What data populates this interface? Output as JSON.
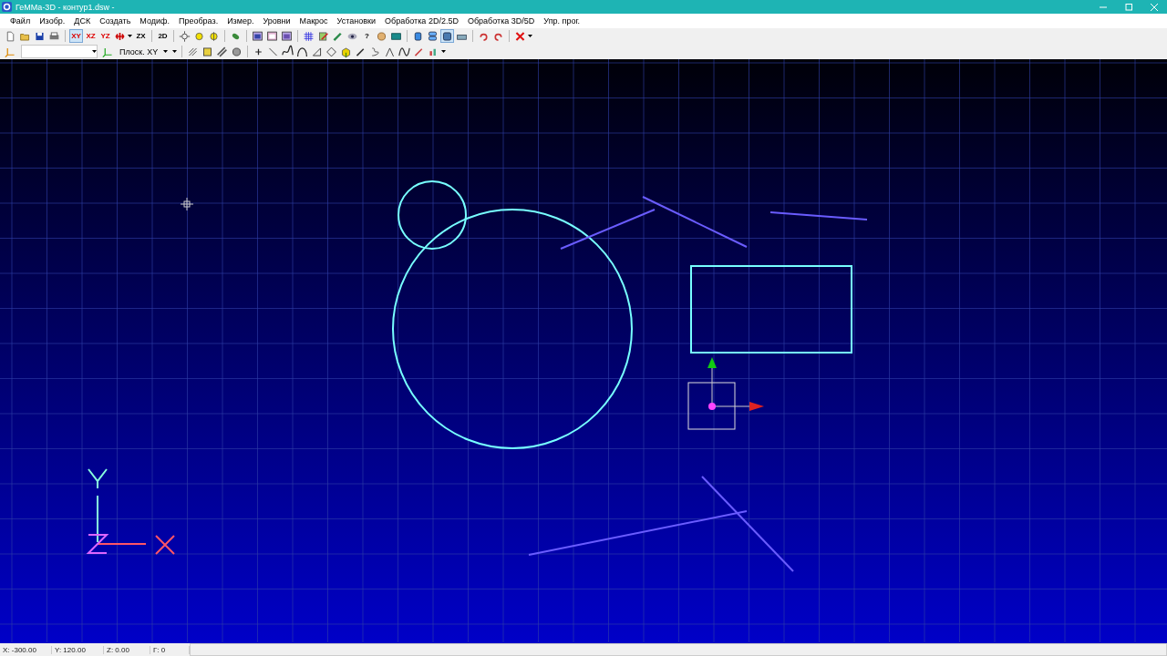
{
  "window": {
    "title": "ГеММа-3D - контур1.dsw -"
  },
  "menu": [
    {
      "label": "Файл"
    },
    {
      "label": "Изобр."
    },
    {
      "label": "ДСК"
    },
    {
      "label": "Создать"
    },
    {
      "label": "Модиф."
    },
    {
      "label": "Преобраз."
    },
    {
      "label": "Измер."
    },
    {
      "label": "Уровни"
    },
    {
      "label": "Макрос"
    },
    {
      "label": "Установки"
    },
    {
      "label": "Обработка 2D/2.5D"
    },
    {
      "label": "Обработка 3D/5D"
    },
    {
      "label": "Упр. прог."
    }
  ],
  "toolbar_1": [
    {
      "kind": "icon",
      "selected": false
    },
    {
      "kind": "icon",
      "selected": false
    },
    {
      "kind": "icon",
      "selected": false
    },
    {
      "kind": "icon",
      "selected": false
    },
    {
      "kind": "sep"
    },
    {
      "kind": "text",
      "label": "XY",
      "selected": true
    },
    {
      "kind": "text",
      "label": "XZ",
      "selected": false
    },
    {
      "kind": "text",
      "label": "YZ",
      "selected": false
    },
    {
      "kind": "icon",
      "selected": false
    },
    {
      "kind": "caret"
    },
    {
      "kind": "text",
      "label": "ZX",
      "selected": false
    },
    {
      "kind": "sep"
    },
    {
      "kind": "text",
      "label": "2D",
      "selected": false
    },
    {
      "kind": "sep"
    },
    {
      "kind": "icon",
      "selected": false
    },
    {
      "kind": "icon",
      "selected": false
    },
    {
      "kind": "icon",
      "selected": false
    },
    {
      "kind": "sep"
    },
    {
      "kind": "icon",
      "selected": false
    },
    {
      "kind": "sep"
    },
    {
      "kind": "icon",
      "selected": false
    },
    {
      "kind": "icon",
      "selected": false
    },
    {
      "kind": "icon",
      "selected": false
    },
    {
      "kind": "sep"
    },
    {
      "kind": "icon",
      "selected": false
    },
    {
      "kind": "icon",
      "selected": false
    },
    {
      "kind": "icon",
      "selected": false
    },
    {
      "kind": "icon",
      "selected": false
    },
    {
      "kind": "text",
      "label": "?",
      "selected": false
    },
    {
      "kind": "icon",
      "selected": false
    },
    {
      "kind": "icon",
      "selected": false
    },
    {
      "kind": "sep"
    },
    {
      "kind": "icon",
      "selected": false
    },
    {
      "kind": "icon",
      "selected": false
    },
    {
      "kind": "icon",
      "selected": true
    },
    {
      "kind": "icon",
      "selected": false
    },
    {
      "kind": "sep"
    },
    {
      "kind": "icon",
      "selected": false
    },
    {
      "kind": "icon",
      "selected": false
    },
    {
      "kind": "sep"
    },
    {
      "kind": "icon",
      "selected": false
    },
    {
      "kind": "caret"
    }
  ],
  "toolbar_2": {
    "plane_select": {
      "value": "Плоск. XY"
    }
  },
  "status_bar": [
    {
      "label": "X:",
      "value": "-300.00"
    },
    {
      "label": "Y:",
      "value": "120.00"
    },
    {
      "label": "Z:",
      "value": "0.00"
    },
    {
      "label": "Г:",
      "value": "0"
    }
  ]
}
